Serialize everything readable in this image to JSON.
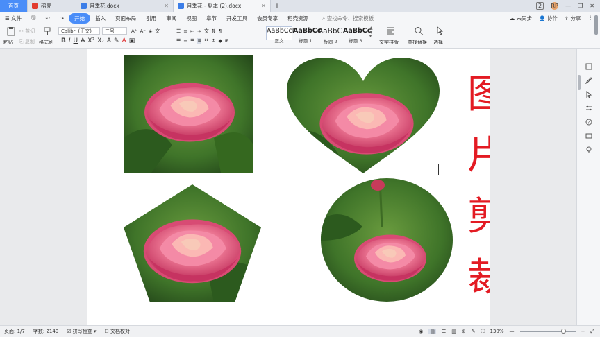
{
  "tabs": {
    "home": "首页",
    "daoke": "稻壳",
    "doc1": "月季花.docx",
    "doc2": "月季花 - 副本 (2).docx",
    "add": "+"
  },
  "window": {
    "badge": "2",
    "avatar_text": "RP"
  },
  "menu": {
    "file": "文件",
    "items": [
      "开始",
      "插入",
      "页面布局",
      "引用",
      "审阅",
      "视图",
      "章节",
      "开发工具",
      "会员专享",
      "稻壳资源"
    ],
    "search_placeholder": "查找命令、搜索模板",
    "unsync": "未同步",
    "collab": "协作",
    "share": "分享"
  },
  "ribbon": {
    "paste": "粘贴",
    "cut": "剪切",
    "copy": "复制",
    "format_painter": "格式刷",
    "font": "Calibri (正文)",
    "size": "三号",
    "styles": [
      {
        "preview": "AaBbCcI",
        "name": "正文"
      },
      {
        "preview": "AaBbCc",
        "name": "标题 1"
      },
      {
        "preview": "AaBbC",
        "name": "标题 2"
      },
      {
        "preview": "AaBbCc",
        "name": "标题 3"
      }
    ],
    "text_layout": "文字排版",
    "find_replace": "查找替换",
    "select": "选择"
  },
  "document": {
    "title_chars": [
      "图",
      "片",
      "剪",
      "裁"
    ]
  },
  "status": {
    "page": "页面: 1/7",
    "words": "字数: 2140",
    "spell": "拼写检查",
    "proof": "文档校对",
    "zoom": "130%",
    "zoom_level_pct": 78
  },
  "colors": {
    "accent": "#4a8df8",
    "title_red": "#e31b23"
  }
}
